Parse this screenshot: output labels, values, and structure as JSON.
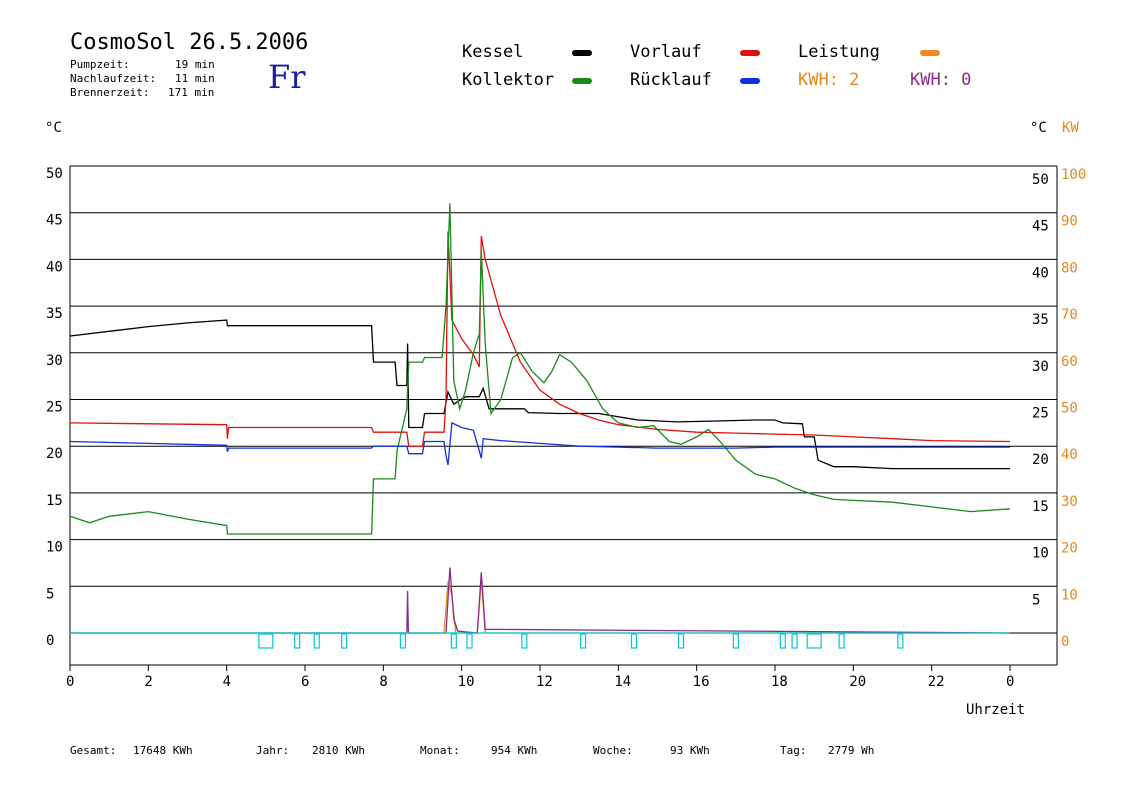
{
  "header": {
    "title": "CosmoSol 26.5.2006",
    "day": "Fr",
    "stats": [
      {
        "label": "Pumpzeit:",
        "value": "19 min"
      },
      {
        "label": "Nachlaufzeit:",
        "value": "11 min"
      },
      {
        "label": "Brennerzeit:",
        "value": "171 min"
      }
    ]
  },
  "legend": {
    "items": [
      {
        "label": "Kessel",
        "color": "#000000"
      },
      {
        "label": "Kollektor",
        "color": "#1a8a1a"
      },
      {
        "label": "Vorlauf",
        "color": "#e01010"
      },
      {
        "label": "Rücklauf",
        "color": "#1030e0"
      },
      {
        "label": "Leistung",
        "color": "#f08a20"
      }
    ],
    "kwh_orange": "KWH: 2",
    "kwh_purple": "KWH: 0"
  },
  "axes": {
    "left_unit": "°C",
    "right_unit": "°C",
    "right_unit2": "KW",
    "xlabel": "Uhrzeit"
  },
  "footer": [
    {
      "label": "Gesamt:",
      "value": "17648 KWh"
    },
    {
      "label": "Jahr:",
      "value": "2810 KWh"
    },
    {
      "label": "Monat:",
      "value": "954 KWh"
    },
    {
      "label": "Woche:",
      "value": "93 KWh"
    },
    {
      "label": "Tag:",
      "value": "2779 Wh"
    }
  ],
  "chart_data": {
    "type": "line",
    "title": "CosmoSol 26.5.2006",
    "xlabel": "Uhrzeit",
    "ylabel": "°C",
    "y2label": "KW",
    "xlim": [
      0,
      24
    ],
    "ylim": [
      0,
      50
    ],
    "y2lim": [
      0,
      100
    ],
    "grid": true,
    "x_ticks": [
      "0",
      "2",
      "4",
      "6",
      "8",
      "10",
      "12",
      "14",
      "16",
      "18",
      "20",
      "22",
      "0"
    ],
    "y_ticks": [
      0,
      5,
      10,
      15,
      20,
      25,
      30,
      35,
      40,
      45,
      50
    ],
    "y2_ticks": [
      0,
      10,
      20,
      30,
      40,
      50,
      60,
      70,
      80,
      90,
      100
    ],
    "series": [
      {
        "name": "Kessel",
        "color": "#000000",
        "points": [
          [
            0,
            31.8
          ],
          [
            1,
            32.3
          ],
          [
            2,
            32.8
          ],
          [
            3,
            33.2
          ],
          [
            4,
            33.5
          ],
          [
            4.02,
            32.9
          ],
          [
            7.7,
            32.9
          ],
          [
            7.75,
            29
          ],
          [
            8.3,
            29
          ],
          [
            8.35,
            26.5
          ],
          [
            8.6,
            26.5
          ],
          [
            8.62,
            31
          ],
          [
            8.65,
            22
          ],
          [
            9.0,
            22
          ],
          [
            9.05,
            23.5
          ],
          [
            9.55,
            23.5
          ],
          [
            9.65,
            25.8
          ],
          [
            9.8,
            24.5
          ],
          [
            10.1,
            25.3
          ],
          [
            10.45,
            25.3
          ],
          [
            10.55,
            26.2
          ],
          [
            10.7,
            24.0
          ],
          [
            11.6,
            24.0
          ],
          [
            11.7,
            23.6
          ],
          [
            12.5,
            23.5
          ],
          [
            13.5,
            23.5
          ],
          [
            14.5,
            22.8
          ],
          [
            15.5,
            22.6
          ],
          [
            16.5,
            22.7
          ],
          [
            17.5,
            22.8
          ],
          [
            18.0,
            22.8
          ],
          [
            18.2,
            22.5
          ],
          [
            18.7,
            22.4
          ],
          [
            18.75,
            21.0
          ],
          [
            19.0,
            21.0
          ],
          [
            19.1,
            18.5
          ],
          [
            19.5,
            17.8
          ],
          [
            20.0,
            17.8
          ],
          [
            21.0,
            17.6
          ],
          [
            22.0,
            17.6
          ],
          [
            23.0,
            17.6
          ],
          [
            24,
            17.6
          ]
        ]
      },
      {
        "name": "Vorlauf",
        "color": "#e01010",
        "points": [
          [
            0,
            22.5
          ],
          [
            4,
            22.3
          ],
          [
            4.02,
            20.8
          ],
          [
            4.05,
            22.0
          ],
          [
            7.7,
            22.0
          ],
          [
            7.75,
            21.5
          ],
          [
            8.6,
            21.5
          ],
          [
            8.65,
            20.0
          ],
          [
            9.0,
            20.0
          ],
          [
            9.05,
            21.5
          ],
          [
            9.55,
            21.5
          ],
          [
            9.6,
            25
          ],
          [
            9.65,
            43
          ],
          [
            9.75,
            33.5
          ],
          [
            10,
            31.5
          ],
          [
            10.3,
            29.8
          ],
          [
            10.45,
            28.5
          ],
          [
            10.5,
            42.5
          ],
          [
            10.6,
            40
          ],
          [
            11.0,
            34
          ],
          [
            11.5,
            29
          ],
          [
            12.0,
            26.0
          ],
          [
            12.5,
            24.5
          ],
          [
            13,
            23.5
          ],
          [
            13.5,
            22.8
          ],
          [
            14,
            22.3
          ],
          [
            15,
            21.8
          ],
          [
            16,
            21.5
          ],
          [
            17,
            21.4
          ],
          [
            18,
            21.3
          ],
          [
            19,
            21.2
          ],
          [
            20,
            21.0
          ],
          [
            21,
            20.8
          ],
          [
            22,
            20.6
          ],
          [
            24,
            20.5
          ]
        ]
      },
      {
        "name": "Kollektor",
        "color": "#1a8a1a",
        "points": [
          [
            0,
            12.5
          ],
          [
            0.5,
            11.8
          ],
          [
            1,
            12.5
          ],
          [
            2,
            13
          ],
          [
            3,
            12.2
          ],
          [
            4,
            11.5
          ],
          [
            4.02,
            10.6
          ],
          [
            7.7,
            10.6
          ],
          [
            7.75,
            16.5
          ],
          [
            8.3,
            16.5
          ],
          [
            8.35,
            19.5
          ],
          [
            8.6,
            24
          ],
          [
            8.65,
            29
          ],
          [
            9.0,
            29
          ],
          [
            9.05,
            29.5
          ],
          [
            9.5,
            29.5
          ],
          [
            9.6,
            35
          ],
          [
            9.7,
            46
          ],
          [
            9.8,
            27
          ],
          [
            9.95,
            24
          ],
          [
            10.1,
            26
          ],
          [
            10.3,
            30
          ],
          [
            10.45,
            32
          ],
          [
            10.5,
            41
          ],
          [
            10.6,
            31
          ],
          [
            10.75,
            23.5
          ],
          [
            11.0,
            25
          ],
          [
            11.3,
            29.5
          ],
          [
            11.5,
            30
          ],
          [
            11.8,
            28
          ],
          [
            12.1,
            26.8
          ],
          [
            12.3,
            28
          ],
          [
            12.5,
            29.8
          ],
          [
            12.8,
            29
          ],
          [
            13.2,
            27
          ],
          [
            13.6,
            24
          ],
          [
            14.0,
            22.5
          ],
          [
            14.5,
            22
          ],
          [
            14.9,
            22.2
          ],
          [
            15.3,
            20.5
          ],
          [
            15.6,
            20.2
          ],
          [
            16.0,
            21
          ],
          [
            16.3,
            21.8
          ],
          [
            16.6,
            20.5
          ],
          [
            17.0,
            18.5
          ],
          [
            17.5,
            17
          ],
          [
            18.0,
            16.5
          ],
          [
            18.5,
            15.5
          ],
          [
            19.0,
            14.8
          ],
          [
            19.5,
            14.3
          ],
          [
            20,
            14.2
          ],
          [
            21,
            14.0
          ],
          [
            22,
            13.5
          ],
          [
            23,
            13.0
          ],
          [
            24,
            13.3
          ]
        ]
      },
      {
        "name": "Rücklauf",
        "color": "#1030e0",
        "points": [
          [
            0,
            20.5
          ],
          [
            4,
            20.1
          ],
          [
            4.02,
            19.4
          ],
          [
            4.05,
            19.8
          ],
          [
            7.7,
            19.8
          ],
          [
            7.75,
            20.0
          ],
          [
            8.6,
            20.0
          ],
          [
            8.65,
            19.2
          ],
          [
            9.0,
            19.2
          ],
          [
            9.05,
            20.5
          ],
          [
            9.55,
            20.5
          ],
          [
            9.6,
            19.0
          ],
          [
            9.65,
            18.0
          ],
          [
            9.75,
            22.5
          ],
          [
            10,
            22.0
          ],
          [
            10.3,
            21.7
          ],
          [
            10.45,
            19.5
          ],
          [
            10.5,
            18.7
          ],
          [
            10.55,
            20.8
          ],
          [
            11.0,
            20.6
          ],
          [
            12,
            20.3
          ],
          [
            13,
            20.0
          ],
          [
            14,
            19.9
          ],
          [
            15,
            19.8
          ],
          [
            16,
            19.8
          ],
          [
            17,
            19.8
          ],
          [
            18,
            19.9
          ],
          [
            19,
            19.9
          ],
          [
            20,
            19.9
          ],
          [
            22,
            19.9
          ],
          [
            24,
            19.9
          ]
        ]
      },
      {
        "name": "Leistung",
        "color": "#f08a20",
        "points": [
          [
            0,
            0
          ],
          [
            9.55,
            0
          ],
          [
            9.65,
            5.5
          ],
          [
            9.75,
            4
          ],
          [
            9.85,
            0
          ],
          [
            10.4,
            0
          ],
          [
            10.5,
            5.8
          ],
          [
            10.6,
            0
          ],
          [
            24,
            0
          ]
        ]
      },
      {
        "name": "",
        "color": "#8a2a8a",
        "points": [
          [
            0,
            0
          ],
          [
            8.6,
            0
          ],
          [
            8.62,
            4.5
          ],
          [
            8.64,
            0
          ],
          [
            9.6,
            0
          ],
          [
            9.7,
            7
          ],
          [
            9.8,
            1.5
          ],
          [
            9.9,
            0.2
          ],
          [
            10.4,
            0
          ],
          [
            10.5,
            6.5
          ],
          [
            10.6,
            0.4
          ],
          [
            24,
            0
          ]
        ]
      },
      {
        "name": "",
        "color": "#00c8d8",
        "points": [
          [
            0,
            0
          ],
          [
            24,
            0
          ]
        ]
      }
    ],
    "pump_markers": [
      5.0,
      5.8,
      6.3,
      7.0,
      8.5,
      9.8,
      10.2,
      11.6,
      13.1,
      14.4,
      15.6,
      17.0,
      18.2,
      18.5,
      19.0,
      19.7,
      21.2
    ]
  }
}
